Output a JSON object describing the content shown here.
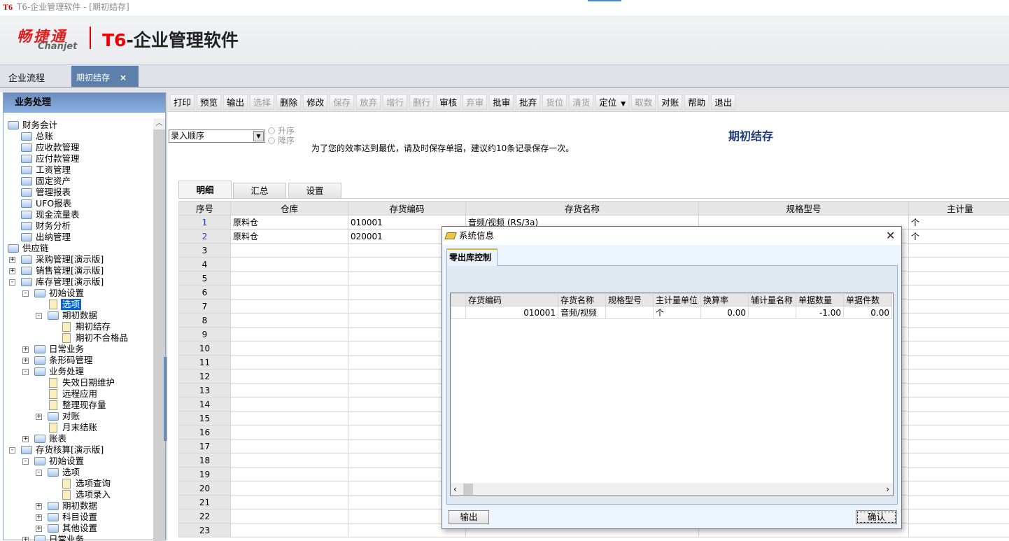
{
  "window": {
    "app_icon": "T6",
    "title": "T6-企业管理软件 - [期初结存]"
  },
  "brand": {
    "cn": "畅捷通",
    "en": "Chanjet",
    "product_prefix": "T6",
    "product_rest": "-企业管理软件"
  },
  "tabs": [
    {
      "label": "企业流程"
    },
    {
      "label": "期初结存",
      "close": "×"
    }
  ],
  "left_panel": {
    "title": "业务处理",
    "scroll_up": "︿"
  },
  "tree": [
    {
      "d": 0,
      "t": "财务会计",
      "i": "folder",
      "e": ""
    },
    {
      "d": 1,
      "t": "总账",
      "i": "folder",
      "e": ""
    },
    {
      "d": 1,
      "t": "应收款管理",
      "i": "folder",
      "e": ""
    },
    {
      "d": 1,
      "t": "应付款管理",
      "i": "folder",
      "e": ""
    },
    {
      "d": 1,
      "t": "工资管理",
      "i": "folder",
      "e": ""
    },
    {
      "d": 1,
      "t": "固定资产",
      "i": "folder",
      "e": ""
    },
    {
      "d": 1,
      "t": "管理报表",
      "i": "folder",
      "e": ""
    },
    {
      "d": 1,
      "t": "UFO报表",
      "i": "folder",
      "e": ""
    },
    {
      "d": 1,
      "t": "现金流量表",
      "i": "folder",
      "e": ""
    },
    {
      "d": 1,
      "t": "财务分析",
      "i": "folder",
      "e": ""
    },
    {
      "d": 1,
      "t": "出纳管理",
      "i": "folder",
      "e": ""
    },
    {
      "d": 0,
      "t": "供应链",
      "i": "folder",
      "e": ""
    },
    {
      "d": 1,
      "t": "采购管理[演示版]",
      "i": "folder",
      "e": "+"
    },
    {
      "d": 1,
      "t": "销售管理[演示版]",
      "i": "folder",
      "e": "+"
    },
    {
      "d": 1,
      "t": "库存管理[演示版]",
      "i": "folder",
      "e": "-"
    },
    {
      "d": 2,
      "t": "初始设置",
      "i": "folder",
      "e": "-"
    },
    {
      "d": 3,
      "t": "选项",
      "i": "doc",
      "e": "",
      "sel": true
    },
    {
      "d": 3,
      "t": "期初数据",
      "i": "folder",
      "e": "-"
    },
    {
      "d": 4,
      "t": "期初结存",
      "i": "doc",
      "e": ""
    },
    {
      "d": 4,
      "t": "期初不合格品",
      "i": "doc",
      "e": ""
    },
    {
      "d": 2,
      "t": "日常业务",
      "i": "folder",
      "e": "+"
    },
    {
      "d": 2,
      "t": "条形码管理",
      "i": "folder",
      "e": "+"
    },
    {
      "d": 2,
      "t": "业务处理",
      "i": "folder",
      "e": "-"
    },
    {
      "d": 3,
      "t": "失效日期维护",
      "i": "doc",
      "e": ""
    },
    {
      "d": 3,
      "t": "远程应用",
      "i": "doc",
      "e": ""
    },
    {
      "d": 3,
      "t": "整理现存量",
      "i": "doc",
      "e": ""
    },
    {
      "d": 3,
      "t": "对账",
      "i": "folder",
      "e": "+"
    },
    {
      "d": 3,
      "t": "月末结账",
      "i": "doc",
      "e": ""
    },
    {
      "d": 2,
      "t": "账表",
      "i": "folder",
      "e": "+"
    },
    {
      "d": 1,
      "t": "存货核算[演示版]",
      "i": "folder",
      "e": "-"
    },
    {
      "d": 2,
      "t": "初始设置",
      "i": "folder",
      "e": "-"
    },
    {
      "d": 3,
      "t": "选项",
      "i": "folder",
      "e": "-"
    },
    {
      "d": 4,
      "t": "选项查询",
      "i": "doc",
      "e": ""
    },
    {
      "d": 4,
      "t": "选项录入",
      "i": "doc",
      "e": ""
    },
    {
      "d": 3,
      "t": "期初数据",
      "i": "folder",
      "e": "+"
    },
    {
      "d": 3,
      "t": "科目设置",
      "i": "folder",
      "e": "+"
    },
    {
      "d": 3,
      "t": "其他设置",
      "i": "folder",
      "e": "+"
    },
    {
      "d": 2,
      "t": "日常业务",
      "i": "folder",
      "e": "+"
    }
  ],
  "toolbar": [
    {
      "l": "打印"
    },
    {
      "l": "预览"
    },
    {
      "l": "输出"
    },
    {
      "l": "选择",
      "dis": true
    },
    {
      "l": "删除"
    },
    {
      "l": "修改"
    },
    {
      "l": "保存",
      "dis": true
    },
    {
      "l": "放弃",
      "dis": true
    },
    {
      "l": "增行",
      "dis": true
    },
    {
      "l": "删行",
      "dis": true
    },
    {
      "l": "审核"
    },
    {
      "l": "弃审",
      "dis": true
    },
    {
      "l": "批审"
    },
    {
      "l": "批弃"
    },
    {
      "l": "货位",
      "dis": true
    },
    {
      "l": "清货",
      "dis": true
    },
    {
      "l": "定位",
      "dd": "▼"
    },
    {
      "l": "取数",
      "dis": true
    },
    {
      "l": "对账"
    },
    {
      "l": "帮助"
    },
    {
      "l": "退出"
    }
  ],
  "form": {
    "sort_value": "录入顺序",
    "sort_arrow": "▼",
    "asc": "升序",
    "desc": "降序",
    "hint": "为了您的效率达到最优，请及时保存单据，建议约10条记录保存一次。",
    "title": "期初结存",
    "subtabs": [
      "明细",
      "汇总",
      "设置"
    ]
  },
  "grid": {
    "columns": [
      "序号",
      "仓库",
      "存货编码",
      "存货名称",
      "规格型号",
      "主计量"
    ],
    "rows": [
      [
        "1",
        "原料仓",
        "010001",
        "音频/视频 (RS/3a)",
        "",
        "个"
      ],
      [
        "2",
        "原料仓",
        "020001",
        "",
        "",
        "个"
      ]
    ],
    "row_count": 23
  },
  "dialog": {
    "title": "系统信息",
    "close": "✕",
    "tab": "零出库控制",
    "columns": [
      "",
      "存货编码",
      "存货名称",
      "规格型号",
      "主计量单位",
      "换算率",
      "辅计量名称",
      "单据数量",
      "单据件数"
    ],
    "rows": [
      [
        "",
        "010001",
        "音频/视频",
        "",
        "个",
        "0.00",
        "",
        "-1.00",
        "0.00"
      ]
    ],
    "scroll_left": "‹",
    "scroll_right": "›",
    "export_label": "输出",
    "ok_label": "确认"
  }
}
